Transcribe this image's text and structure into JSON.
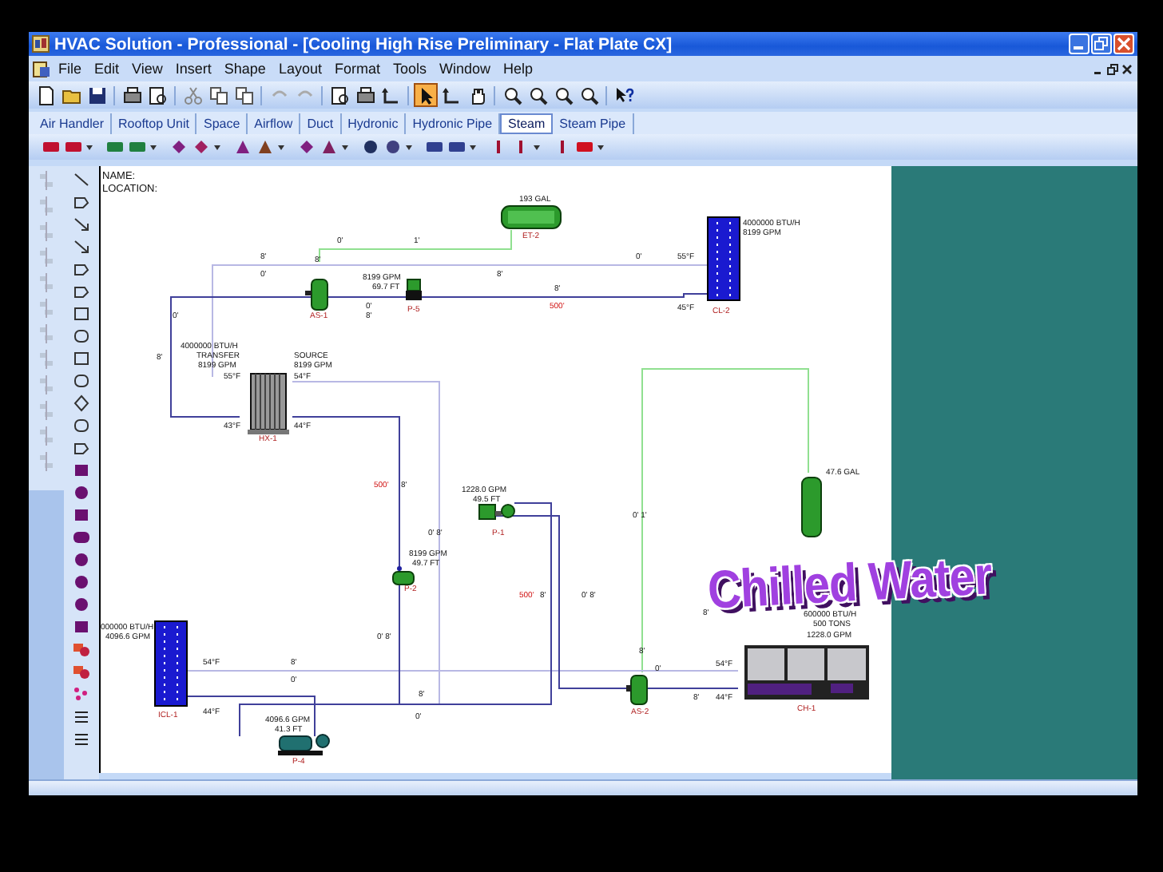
{
  "window": {
    "title": "HVAC Solution - Professional - [Cooling High Rise Preliminary - Flat Plate CX]"
  },
  "menu": [
    "File",
    "Edit",
    "View",
    "Insert",
    "Shape",
    "Layout",
    "Format",
    "Tools",
    "Window",
    "Help"
  ],
  "toolbar_buttons": [
    {
      "selected": false
    },
    {
      "selected": false
    },
    {
      "selected": false
    },
    {
      "selected": false
    },
    {
      "selected": false
    },
    {
      "selected": false
    },
    {
      "selected": false
    },
    {
      "selected": false
    },
    {
      "selected": false
    },
    {
      "selected": false
    },
    {
      "selected": false
    },
    {
      "selected": false
    },
    {
      "selected": false
    },
    {
      "selected": true
    },
    {
      "selected": false
    },
    {
      "selected": false
    },
    {
      "selected": false
    },
    {
      "selected": false
    },
    {
      "selected": false
    },
    {
      "selected": false
    },
    {
      "selected": false
    }
  ],
  "tabs": [
    {
      "label": "Air Handler",
      "selected": false
    },
    {
      "label": "Rooftop Unit",
      "selected": false
    },
    {
      "label": "Space",
      "selected": false
    },
    {
      "label": "Airflow",
      "selected": false
    },
    {
      "label": "Duct",
      "selected": false
    },
    {
      "label": "Hydronic",
      "selected": false
    },
    {
      "label": "Hydronic Pipe",
      "selected": false
    },
    {
      "label": "Steam",
      "selected": true
    },
    {
      "label": "Steam Pipe",
      "selected": false
    }
  ],
  "diagram": {
    "name_label": "NAME:",
    "location_label": "LOCATION:",
    "overlay_title": "Chilled Water",
    "labels": [
      {
        "text": "193 GAL",
        "kind": "value"
      },
      {
        "text": "ET-2",
        "kind": "tag"
      },
      {
        "text": "0'",
        "kind": "value"
      },
      {
        "text": "1'",
        "kind": "value"
      },
      {
        "text": "8'",
        "kind": "value"
      },
      {
        "text": "0'",
        "kind": "value"
      },
      {
        "text": "8'",
        "kind": "value"
      },
      {
        "text": "0'",
        "kind": "value"
      },
      {
        "text": "55°F",
        "kind": "value"
      },
      {
        "text": "4000000 BTU/H",
        "kind": "value"
      },
      {
        "text": "8199 GPM",
        "kind": "value"
      },
      {
        "text": "8199 GPM",
        "kind": "value"
      },
      {
        "text": "69.7 FT",
        "kind": "value"
      },
      {
        "text": "0'",
        "kind": "value"
      },
      {
        "text": "8'",
        "kind": "value"
      },
      {
        "text": "8'",
        "kind": "value"
      },
      {
        "text": "8'",
        "kind": "value"
      },
      {
        "text": "500'",
        "kind": "length"
      },
      {
        "text": "45°F",
        "kind": "value"
      },
      {
        "text": "CL-2",
        "kind": "tag"
      },
      {
        "text": "AS-1",
        "kind": "tag"
      },
      {
        "text": "P-5",
        "kind": "tag"
      },
      {
        "text": "0'",
        "kind": "value"
      },
      {
        "text": "8'",
        "kind": "value"
      },
      {
        "text": "4000000 BTU/H",
        "kind": "value"
      },
      {
        "text": "TRANSFER",
        "kind": "value"
      },
      {
        "text": "8199 GPM",
        "kind": "value"
      },
      {
        "text": "SOURCE",
        "kind": "value"
      },
      {
        "text": "8199 GPM",
        "kind": "value"
      },
      {
        "text": "55°F",
        "kind": "value"
      },
      {
        "text": "54°F",
        "kind": "value"
      },
      {
        "text": "43°F",
        "kind": "value"
      },
      {
        "text": "44°F",
        "kind": "value"
      },
      {
        "text": "HX-1",
        "kind": "tag"
      },
      {
        "text": "500'",
        "kind": "length"
      },
      {
        "text": "8'",
        "kind": "value"
      },
      {
        "text": "1228.0 GPM",
        "kind": "value"
      },
      {
        "text": "49.5 FT",
        "kind": "value"
      },
      {
        "text": "P-1",
        "kind": "tag"
      },
      {
        "text": "0' 8'",
        "kind": "value"
      },
      {
        "text": "0' 1'",
        "kind": "value"
      },
      {
        "text": "47.6 GAL",
        "kind": "value"
      },
      {
        "text": "8199 GPM",
        "kind": "value"
      },
      {
        "text": "49.7 FT",
        "kind": "value"
      },
      {
        "text": "P-2",
        "kind": "tag"
      },
      {
        "text": "500'",
        "kind": "length"
      },
      {
        "text": "8'",
        "kind": "value"
      },
      {
        "text": "0' 8'",
        "kind": "value"
      },
      {
        "text": "8'",
        "kind": "value"
      },
      {
        "text": "600000 BTU/H",
        "kind": "value"
      },
      {
        "text": "000000 BTU/H",
        "kind": "value"
      },
      {
        "text": "500 TONS",
        "kind": "value"
      },
      {
        "text": "4096.6 GPM",
        "kind": "value"
      },
      {
        "text": "0' 8'",
        "kind": "value"
      },
      {
        "text": "1228.0 GPM",
        "kind": "value"
      },
      {
        "text": "8'",
        "kind": "value"
      },
      {
        "text": "0'",
        "kind": "value"
      },
      {
        "text": "54°F",
        "kind": "value"
      },
      {
        "text": "8'",
        "kind": "value"
      },
      {
        "text": "0'",
        "kind": "value"
      },
      {
        "text": "54°F",
        "kind": "value"
      },
      {
        "text": "8'",
        "kind": "value"
      },
      {
        "text": "44°F",
        "kind": "value"
      },
      {
        "text": "8'",
        "kind": "value"
      },
      {
        "text": "44°F",
        "kind": "value"
      },
      {
        "text": "AS-2",
        "kind": "tag"
      },
      {
        "text": "CH-1",
        "kind": "tag"
      },
      {
        "text": "ICL-1",
        "kind": "tag"
      },
      {
        "text": "0'",
        "kind": "value"
      },
      {
        "text": "4096.6 GPM",
        "kind": "value"
      },
      {
        "text": "41.3 FT",
        "kind": "value"
      },
      {
        "text": "P-4",
        "kind": "tag"
      }
    ]
  }
}
